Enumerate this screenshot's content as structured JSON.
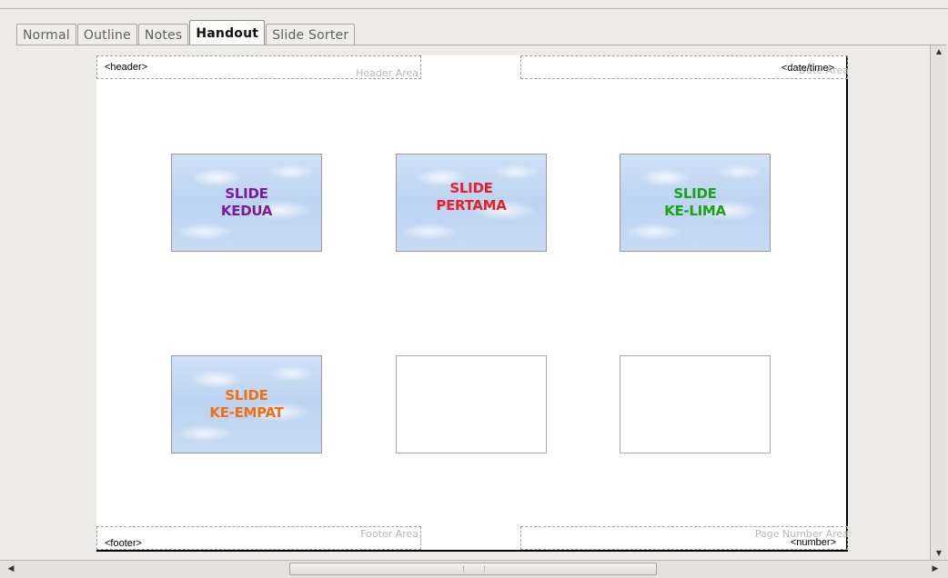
{
  "tabs": [
    {
      "label": "Normal"
    },
    {
      "label": "Outline"
    },
    {
      "label": "Notes"
    },
    {
      "label": "Handout"
    },
    {
      "label": "Slide Sorter"
    }
  ],
  "active_tab": "Handout",
  "handout": {
    "header_area": {
      "placeholder": "Header Area",
      "value": "<header>"
    },
    "date_area": {
      "placeholder": "Date Area",
      "value": "<date/time>"
    },
    "footer_area": {
      "placeholder": "Footer Area",
      "value": "<footer>"
    },
    "number_area": {
      "placeholder": "Page Number Area",
      "value": "<number>"
    }
  },
  "slides": [
    {
      "line1": "SLIDE",
      "line2": "KEDUA",
      "color": "#7b1a9a"
    },
    {
      "line1": "SLIDE",
      "line2": "PERTAMA",
      "color": "#e8202a"
    },
    {
      "line1": "SLIDE",
      "line2": "KE-LIMA",
      "color": "#1aa31a"
    },
    {
      "line1": "SLIDE",
      "line2": "KE-EMPAT",
      "color": "#f07010"
    },
    {
      "line1": "",
      "line2": "",
      "color": ""
    },
    {
      "line1": "",
      "line2": "",
      "color": ""
    }
  ],
  "scrollbars": {
    "up_icon": "arrow-up-icon",
    "down_icon": "arrow-down-icon",
    "left_icon": "arrow-left-icon",
    "right_icon": "arrow-right-icon"
  }
}
